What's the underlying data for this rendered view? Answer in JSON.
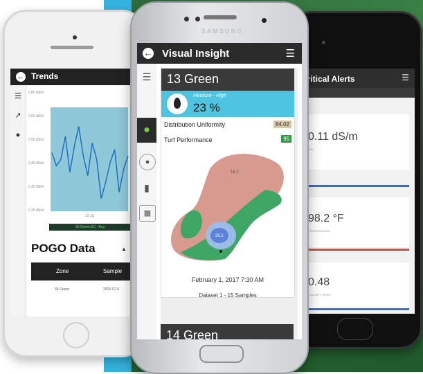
{
  "left_phone": {
    "title": "Trends",
    "chart_data": {
      "type": "line",
      "legend": "55 Green EC - Avg",
      "y_ticks": [
        "0.80 dS/m",
        "0.60 dS/m",
        "0.50 dS/m",
        "0.40 dS/m",
        "0.30 dS/m",
        "0.25 dS/m"
      ],
      "x_ticks": [
        "12 Jul"
      ],
      "series": [
        {
          "name": "55 Green EC - Avg",
          "values": [
            0.42,
            0.38,
            0.4,
            0.47,
            0.36,
            0.44,
            0.5,
            0.41,
            0.35,
            0.45,
            0.4,
            0.28,
            0.33,
            0.39,
            0.43,
            0.3,
            0.37,
            0.41
          ]
        }
      ]
    },
    "pogo_title": "POGO Data",
    "table": {
      "headers": [
        "Zone",
        "Sample"
      ],
      "rows": [
        [
          "55 Green",
          "2015-07-0"
        ]
      ]
    }
  },
  "center_phone": {
    "brand": "SAMSUNG",
    "app_title": "Visual Insight",
    "green_title": "13 Green",
    "moisture_label": "Moisture - High",
    "moisture_value": "23 %",
    "metrics": [
      {
        "label": "Distribution Uniformity",
        "value": "84.02"
      },
      {
        "label": "Turf Performance",
        "value": "95"
      }
    ],
    "map_label": "16.2",
    "map_label2": "20.1",
    "date": "February 1, 2017 7:30 AM",
    "dataset": "Dataset 1 - 15 Samples",
    "next_green_title": "14 Green"
  },
  "right_phone": {
    "title": "Critical Alerts",
    "subbar": "en",
    "small_text": "05",
    "cards": [
      {
        "value": "0.11 dS/m",
        "label": "EC"
      },
      {
        "value": "98.2 °F",
        "label": "TEMPERATURE"
      },
      {
        "value": "0.48",
        "label": "SALINITY INDEX"
      }
    ]
  },
  "colors": {
    "header": "#2b2b2b",
    "moisture_blue": "#4fc4e0",
    "green_accent": "#2e9d3f",
    "alert_blue": "#2a6fd4",
    "alert_red": "#d84a3a"
  }
}
